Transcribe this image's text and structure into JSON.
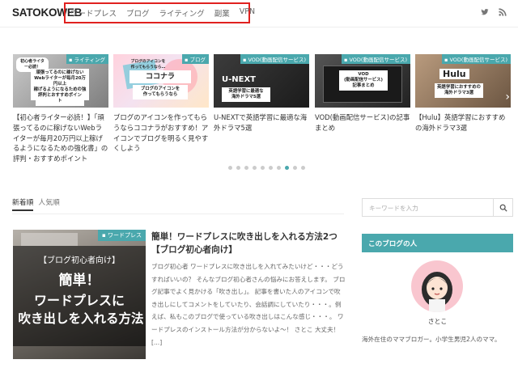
{
  "site": {
    "logo": "SATOKOWEB",
    "nav": [
      "ワードプレス",
      "ブログ",
      "ライティング",
      "副業",
      "VPN"
    ],
    "icons": [
      "twitter-icon",
      "rss-icon"
    ]
  },
  "slider": {
    "cards": [
      {
        "category": "ライティング",
        "title": "【初心者ライター必読！】「頑張ってるのに稼げないWebライターが毎月20万円以上稼げるようになるための強化書」の評判・おすすめポイント",
        "thumb_texts": [
          "初心者ライター必読！",
          "頑張ってるのに稼げない",
          "Webライターが毎月20万円以上",
          "稼げるようになるための強化書",
          "評判とおすすめポイント"
        ]
      },
      {
        "category": "ブログ",
        "title": "ブログのアイコンを作ってもらうならココナラがおすすめ！アイコンでブログを明るく見やすくしよう",
        "thumb_texts": [
          "ブログのアイコンを",
          "作ってもらうなら…",
          "ココナラ",
          "ブログのアイコンを",
          "作ってもらうなら"
        ]
      },
      {
        "category": "VOD(動画配信サービス)",
        "title": "U-NEXTで英語学習に最適な海外ドラマ5選",
        "thumb_texts": [
          "U-NEXT",
          "英語学習に最適な",
          "海外ドラマ5選"
        ]
      },
      {
        "category": "VOD(動画配信サービス)",
        "title": "VOD(動画配信サービス)の記事まとめ",
        "thumb_texts": [
          "VOD",
          "(動画配信サービス)",
          "記事まとめ"
        ]
      },
      {
        "category": "VOD(動画配信サービス)",
        "title": "【Hulu】英語学習におすすめの海外ドラマ3選",
        "thumb_texts": [
          "Hulu",
          "英語学習におすすめの",
          "海外ドラマ3選"
        ]
      }
    ],
    "dots_count": 10,
    "active_dot": 7
  },
  "tabs": [
    "新着順",
    "人気順"
  ],
  "article": {
    "category": "ワードプレス",
    "thumb_lines": [
      "【ブログ初心者向け】",
      "簡単！",
      "ワードプレスに",
      "吹き出しを入れる方法"
    ],
    "title": "簡単！ワードプレスに吹き出しを入れる方法2つ【ブログ初心者向け】",
    "excerpt": "ブログ初心者 ワードプレスに吹き出しを入れてみたいけど・・・どうすればいいの？ そんなブログ初心者さんの悩みにお答えします。 ブログ記事でよく見かける「吹き出し」。 記事を書いた人のアイコンで吹き出しにしてコメントをしていたり、会話調にしていたり・・・。例えば、私もこのブログで使っている吹き出しはこんな感じ・・・。 ワードプレスのインストール方法が分からないよ～！ さとこ 大丈夫！ [...]"
  },
  "sidebar": {
    "search_placeholder": "キーワードを入力",
    "widget_title": "このブログの人",
    "author": "さとこ",
    "bio": "海外在住のママブロガー。小学生男児2人のママ。"
  },
  "colors": {
    "accent": "#4aa8ad",
    "highlight_box": "#e0211f"
  }
}
